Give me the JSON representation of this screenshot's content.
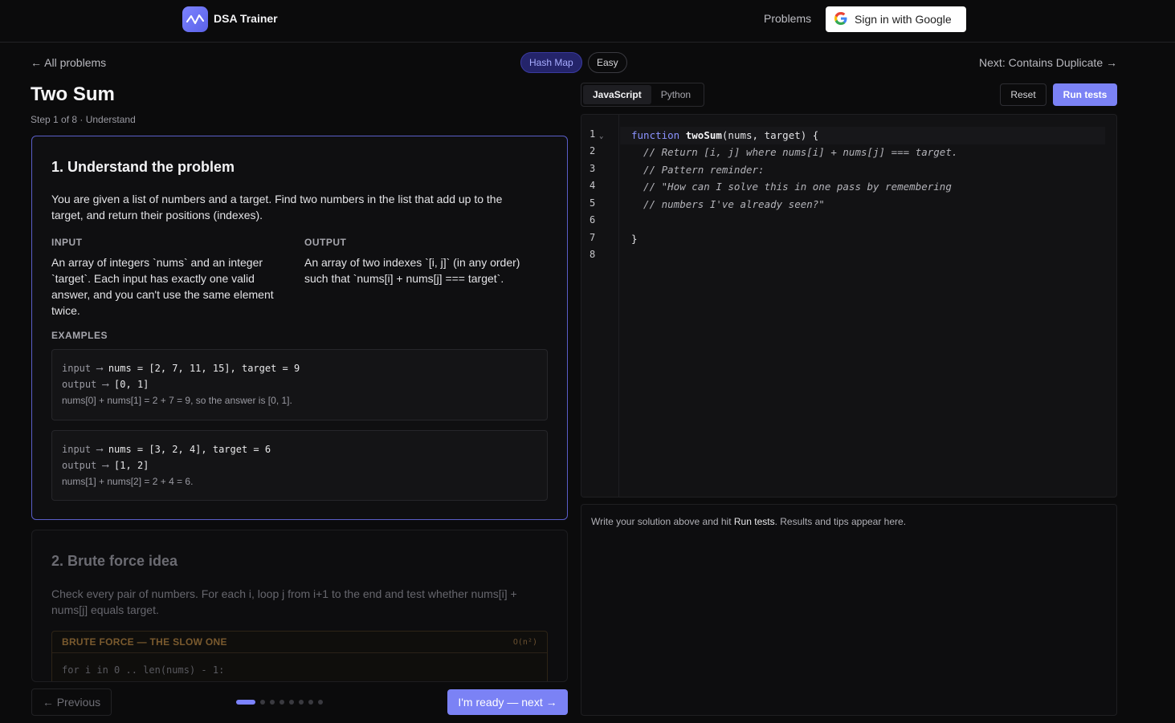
{
  "header": {
    "brand": "DSA Trainer",
    "nav_problems": "Problems",
    "signin_label": "Sign in with Google"
  },
  "subbar": {
    "back_link": "← All problems",
    "tags": [
      "Hash Map",
      "Easy"
    ],
    "next_link": "Next: Contains Duplicate →"
  },
  "problem": {
    "title": "Two Sum",
    "step": "Step 1 of 8 · Understand"
  },
  "card1": {
    "heading": "1. Understand the problem",
    "description": "You are given a list of numbers and a target. Find two numbers in the list that add up to the target, and return their positions (indexes).",
    "input_label": "INPUT",
    "input_text": "An array of integers `nums` and an integer `target`. Each input has exactly one valid answer, and you can't use the same element twice.",
    "output_label": "OUTPUT",
    "output_text": "An array of two indexes `[i, j]` (in any order) such that `nums[i] + nums[j] === target`.",
    "examples_label": "EXAMPLES",
    "examples": [
      {
        "input_key": "input",
        "input_value": "nums = [2, 7, 11, 15], target = 9",
        "output_key": "output",
        "output_value": "[0, 1]",
        "note": "nums[0] + nums[1] = 2 + 7 = 9, so the answer is [0, 1]."
      },
      {
        "input_key": "input",
        "input_value": "nums = [3, 2, 4], target = 6",
        "output_key": "output",
        "output_value": "[1, 2]",
        "note": "nums[1] + nums[2] = 2 + 4 = 6."
      }
    ]
  },
  "card2": {
    "heading": "2. Brute force idea",
    "description": "Check every pair of numbers. For each i, loop j from i+1 to the end and test whether nums[i] + nums[j] equals target.",
    "block_title": "BRUTE FORCE — THE SLOW ONE",
    "complexity": "O(n²)",
    "code_line": "for i in 0 .. len(nums) - 1:"
  },
  "footer": {
    "prev_label": "← Previous",
    "next_label": "I'm ready — next →",
    "steps_total": 8,
    "step_current": 1
  },
  "editor": {
    "languages": [
      "JavaScript",
      "Python"
    ],
    "active_language": "JavaScript",
    "reset_label": "Reset",
    "run_label": "Run tests",
    "line_numbers": [
      "1",
      "2",
      "3",
      "4",
      "5",
      "6",
      "7",
      "8"
    ],
    "code": {
      "kw": "function",
      "fn": "twoSum",
      "sig": "(nums, target) {",
      "c1": "  // Return [i, j] where nums[i] + nums[j] === target.",
      "c2": "  // Pattern reminder:",
      "c3": "  // \"How can I solve this in one pass by remembering",
      "c4": "  // numbers I've already seen?\"",
      "close": "}"
    }
  },
  "output_panel": {
    "pre": "Write your solution above and hit ",
    "bold": "Run tests",
    "post": ". Results and tips appear here."
  },
  "colors": {
    "accent": "#7b82f5",
    "background": "#0b0b0c"
  }
}
